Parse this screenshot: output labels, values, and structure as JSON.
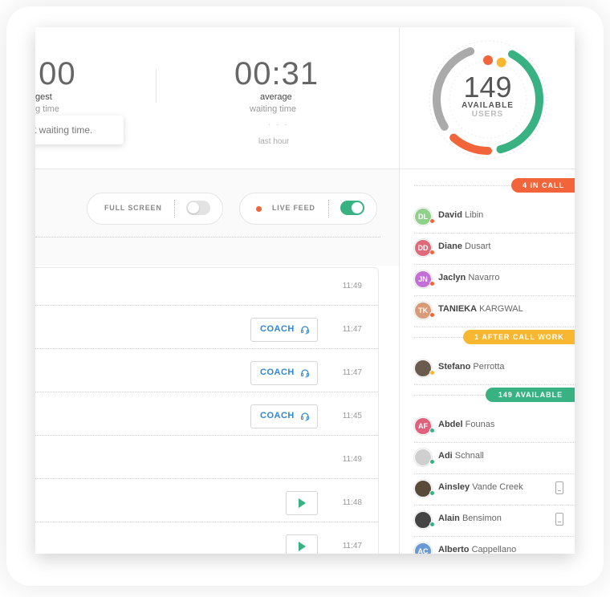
{
  "stats": {
    "longest_value": ":00",
    "longest_label": "gest",
    "longest_sub": "g time",
    "tooltip": "t waiting time.",
    "average_value": "00:31",
    "average_label": "average",
    "average_sub": "waiting time",
    "average_dots": "· · ·",
    "average_period": "last hour"
  },
  "toolbar": {
    "fullscreen_label": "FULL SCREEN",
    "fullscreen_on": false,
    "livefeed_label": "LIVE FEED",
    "livefeed_on": true
  },
  "calls": [
    {
      "time": "11:49",
      "action": "none"
    },
    {
      "time": "11:47",
      "action": "coach",
      "label": "COACH"
    },
    {
      "time": "11:47",
      "action": "coach",
      "label": "COACH"
    },
    {
      "time": "11:45",
      "action": "coach",
      "label": "COACH"
    },
    {
      "time": "11:49",
      "action": "none"
    },
    {
      "time": "11:48",
      "action": "play"
    },
    {
      "time": "11:47",
      "action": "play"
    }
  ],
  "availability": {
    "count": "149",
    "label": "AVAILABLE",
    "sublabel": "USERS",
    "colors": {
      "available": "#38b183",
      "in_call": "#f2643a",
      "after_call": "#f7b731",
      "offline": "#aaaaaa"
    }
  },
  "groups": {
    "in_call": "4 IN CALL",
    "after_call": "1 AFTER CALL WORK",
    "available": "149 AVAILABLE"
  },
  "users_in_call": [
    {
      "initials": "DL",
      "first": "David",
      "last": "Libin",
      "color": "#8fd18a"
    },
    {
      "initials": "DD",
      "first": "Diane",
      "last": "Dusart",
      "color": "#e06a7a"
    },
    {
      "initials": "JN",
      "first": "Jaclyn",
      "last": "Navarro",
      "color": "#c46fd6"
    },
    {
      "initials": "TK",
      "first": "TANIEKA",
      "last": "KARGWAL",
      "color": "#d99a7a"
    }
  ],
  "users_after_call": [
    {
      "initials": "",
      "first": "Stefano",
      "last": "Perrotta",
      "color": "#6b5a4e"
    }
  ],
  "users_available": [
    {
      "initials": "AF",
      "first": "Abdel",
      "last": "Founas",
      "color": "#e0607e",
      "phone": false
    },
    {
      "initials": "",
      "first": "Adi",
      "last": "Schnall",
      "color": "#cfcfcf",
      "phone": false
    },
    {
      "initials": "",
      "first": "Ainsley",
      "last": "Vande Creek",
      "color": "#5a4a3a",
      "phone": true
    },
    {
      "initials": "",
      "first": "Alain",
      "last": "Bensimon",
      "color": "#444444",
      "phone": true
    },
    {
      "initials": "AC",
      "first": "Alberto",
      "last": "Cappellano",
      "color": "#6a9ad6",
      "phone": false
    }
  ]
}
